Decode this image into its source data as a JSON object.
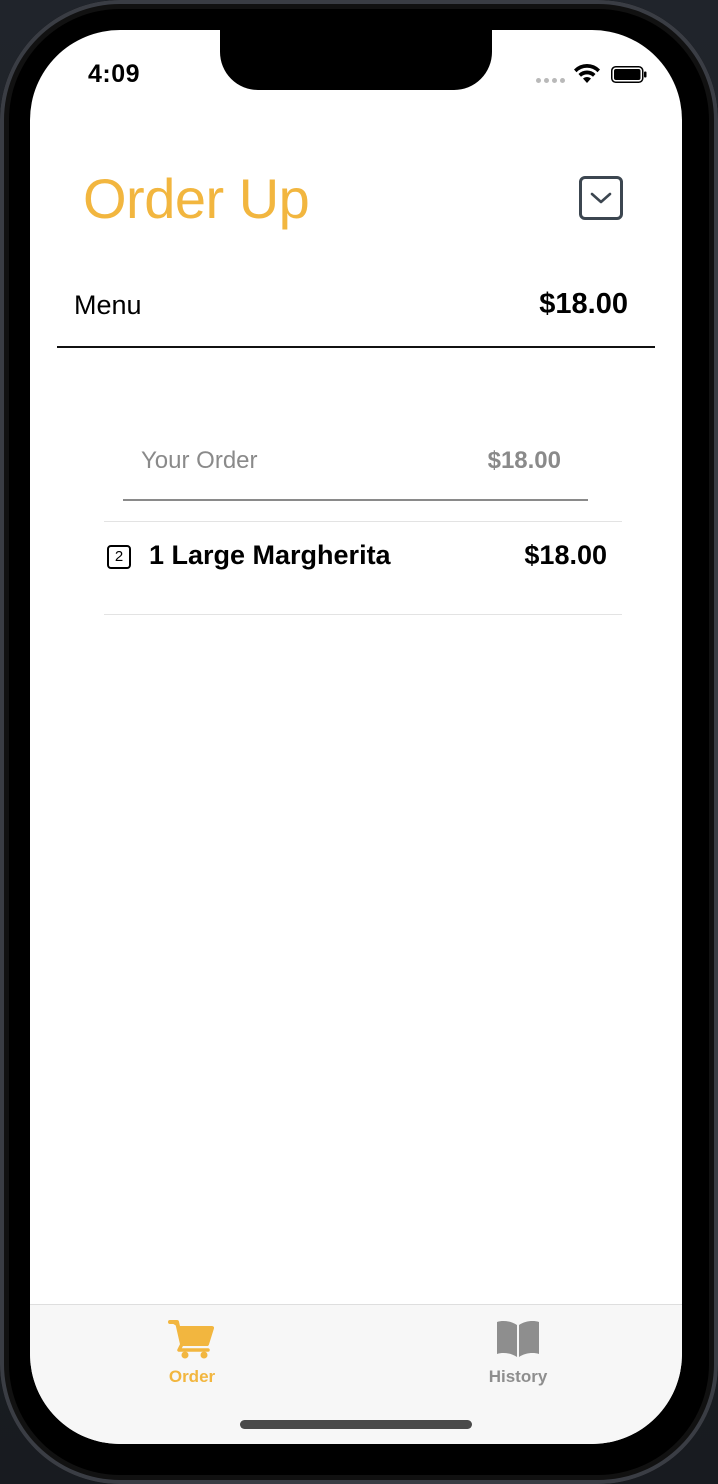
{
  "status_bar": {
    "time": "4:09"
  },
  "header": {
    "title": "Order Up",
    "collapse_icon": "chevron-down-square-icon"
  },
  "menu": {
    "label": "Menu",
    "total": "$18.00"
  },
  "order": {
    "label": "Your Order",
    "total": "$18.00",
    "items": [
      {
        "quantity": "2",
        "name": "1 Large Margherita",
        "price": "$18.00"
      }
    ]
  },
  "tab_bar": {
    "tabs": [
      {
        "label": "Order",
        "icon": "cart-icon",
        "active": true
      },
      {
        "label": "History",
        "icon": "book-icon",
        "active": false
      }
    ]
  },
  "colors": {
    "accent": "#f2b63f",
    "secondary_text": "#8a8a8a"
  }
}
